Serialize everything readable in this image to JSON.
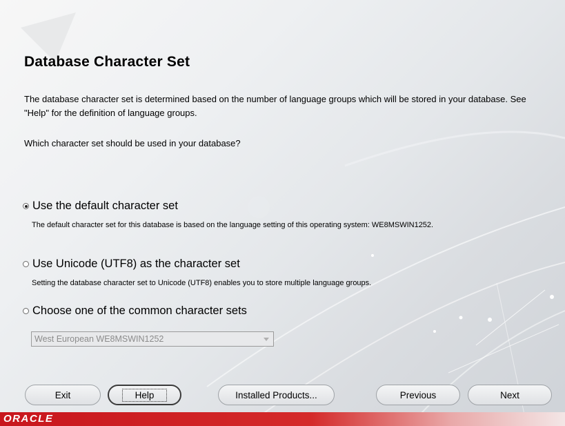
{
  "page": {
    "title": "Database Character Set",
    "description": "The database character set is determined based on the number of language groups which will be stored in your database.  See \"Help\" for the definition of language groups.",
    "question": "Which character set should be used in your database?"
  },
  "options": [
    {
      "label": "Use the default character set",
      "description": "The default character set for this database is based on the language setting of this operating system: WE8MSWIN1252.",
      "selected": true
    },
    {
      "label": "Use Unicode (UTF8) as the character set",
      "description": "Setting the database character set to Unicode (UTF8) enables you to store multiple language groups.",
      "selected": false
    },
    {
      "label": "Choose one of the common character sets",
      "description": "",
      "selected": false
    }
  ],
  "charset_select": {
    "value": "West European WE8MSWIN1252",
    "enabled": false
  },
  "buttons": {
    "exit": "Exit",
    "help": "Help",
    "installed_products": "Installed Products...",
    "previous": "Previous",
    "next": "Next"
  },
  "footer": {
    "logo": "ORACLE"
  },
  "colors": {
    "oracle_red": "#c8161d",
    "background": "#e4e7ea"
  }
}
